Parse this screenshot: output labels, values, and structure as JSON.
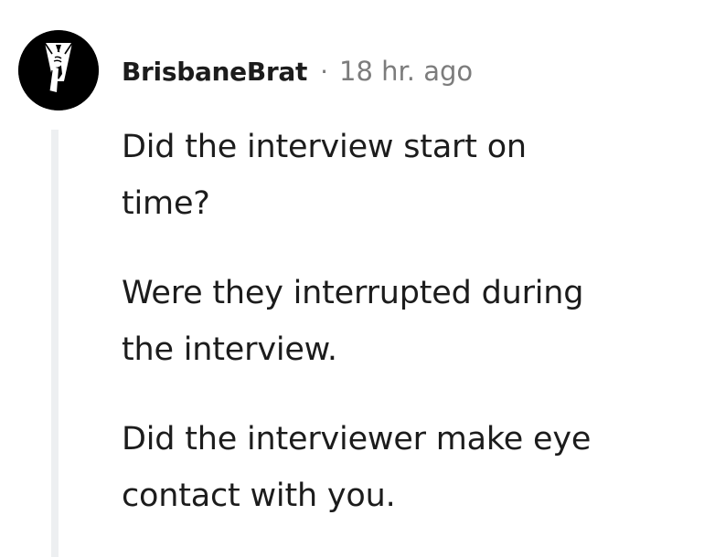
{
  "comment": {
    "username": "BrisbaneBrat",
    "separator": "·",
    "timestamp": "18 hr. ago",
    "avatar_icon": "suit-and-tie-avatar-icon",
    "paragraphs": [
      [
        "Did the interview start on",
        "time?"
      ],
      [
        "Were they interrupted during",
        "the interview."
      ],
      [
        "Did the interviewer make eye",
        "contact with you."
      ]
    ]
  },
  "colors": {
    "text": "#1c1c1c",
    "meta_text": "#7c7c7c",
    "thread_line": "#edeff1",
    "avatar_bg": "#000000"
  }
}
